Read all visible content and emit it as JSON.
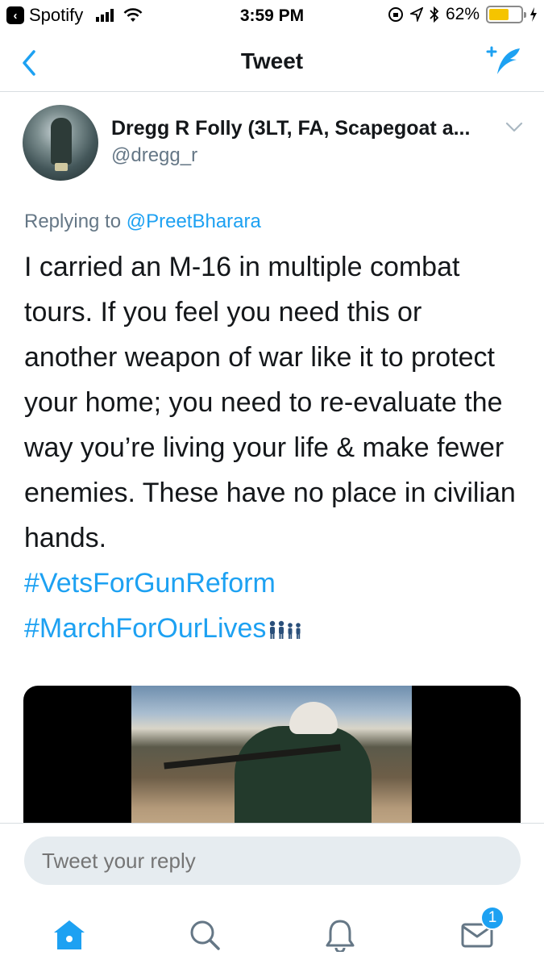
{
  "status_bar": {
    "back_app": "Spotify",
    "time": "3:59 PM",
    "battery": "62%",
    "battery_level": 0.62
  },
  "nav": {
    "title": "Tweet"
  },
  "tweet": {
    "display_name": "Dregg R Folly (3LT, FA, Scapegoat a...",
    "handle": "@dregg_r",
    "replying_prefix": "Replying to ",
    "replying_to": "@PreetBharara",
    "body": "I carried an M-16 in multiple combat tours. If you feel you need this or another weapon of war like it to protect your home; you need to re-evaluate the way you’re living your life & make fewer enemies. These have no place in civilian hands.",
    "hashtags": [
      "#VetsForGunReform",
      "#MarchForOurLives"
    ]
  },
  "reply": {
    "placeholder": "Tweet your reply"
  },
  "tab_bar": {
    "messages_badge": "1"
  },
  "colors": {
    "accent": "#1da1f2",
    "secondary_text": "#657786",
    "divider": "#d8dde1",
    "reply_input_bg": "#e6ecf0",
    "battery_fill": "#f5c400"
  },
  "icons": [
    "back-chevron-icon",
    "compose-tweet-icon",
    "caret-down-icon",
    "home-icon",
    "search-icon",
    "bell-icon",
    "mail-icon",
    "family-emoji-icon"
  ]
}
